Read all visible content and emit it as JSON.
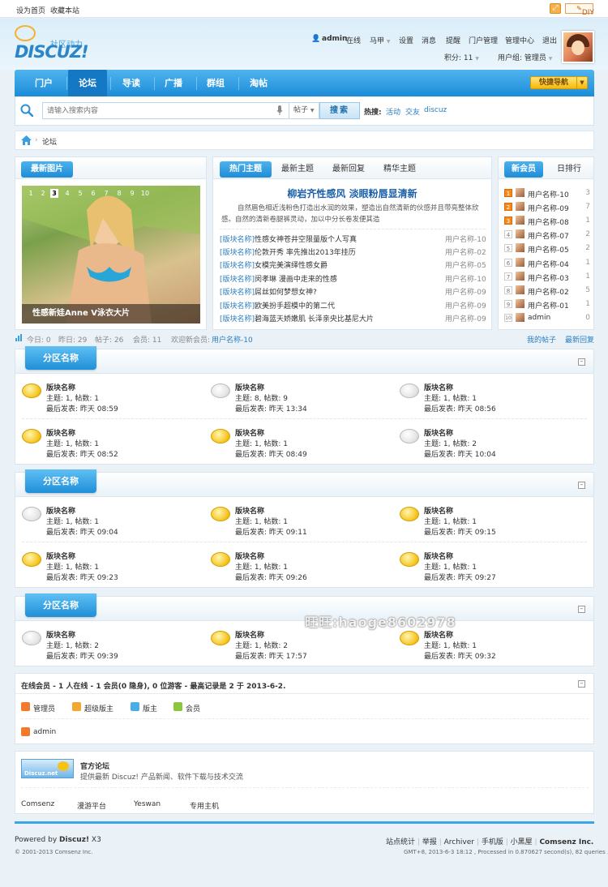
{
  "topbar": {
    "set_home": "设为首页",
    "bookmark": "收藏本站",
    "diy": "DIY"
  },
  "logo": {
    "main": "DISCUZ!",
    "sub": "社区动力"
  },
  "user": {
    "name": "admin",
    "status": "在线",
    "mount": "马甲",
    "settings": "设置",
    "messages": "消息",
    "remind": "提醒",
    "portal_manage": "门户管理",
    "admin_center": "管理中心",
    "logout": "退出",
    "points": "积分: 11",
    "group": "用户组: 管理员"
  },
  "nav": {
    "items": [
      "门户",
      "论坛",
      "导读",
      "广播",
      "群组",
      "淘帖"
    ],
    "active": 1,
    "quick_nav": "快捷导航"
  },
  "search": {
    "placeholder": "请输入搜索内容",
    "type": "帖子",
    "button": "搜索",
    "hot_label": "热搜:",
    "hot": [
      "活动",
      "交友",
      "discuz"
    ]
  },
  "breadcrumb": {
    "current": "论坛"
  },
  "photo_box": {
    "tab": "最新图片",
    "pages": [
      "1",
      "2",
      "3",
      "4",
      "5",
      "6",
      "7",
      "8",
      "9",
      "10"
    ],
    "current_page": 3,
    "caption": "性感新娃Anne V泳衣大片"
  },
  "threads_box": {
    "tabs": [
      "热门主题",
      "最新主题",
      "最新回复",
      "精华主题"
    ],
    "headline": "柳岩齐性感风 淡眼粉唇显清新",
    "summary": "自然眉色相近浅粉色打造出水润的效果，塑造出自然清新的伙感并且带亮整体欣感。自然的清新卷腿裤灵动，加以中分长卷发便其造",
    "items": [
      {
        "forum": "[版块名称]",
        "title": "性感女神苍井空限量版个人写真",
        "author": "用户名称-10"
      },
      {
        "forum": "[版块名称]",
        "title": "伦敦开秀 率先推出2013年挂历",
        "author": "用户名称-02"
      },
      {
        "forum": "[版块名称]",
        "title": "女模完美演绎性感女爵",
        "author": "用户名称-05"
      },
      {
        "forum": "[版块名称]",
        "title": "闵孝琳 漫画中走来的性感",
        "author": "用户名称-10"
      },
      {
        "forum": "[版块名称]",
        "title": "屌丝如何梦想女神?",
        "author": "用户名称-09"
      },
      {
        "forum": "[版块名称]",
        "title": "欧美扮手超模中的第二代",
        "author": "用户名称-09"
      },
      {
        "forum": "[版块名称]",
        "title": "碧海蓝天娇嫩肌 长泽亲央比基尼大片",
        "author": "用户名称-09"
      }
    ]
  },
  "members_box": {
    "tabs": [
      "新会员",
      "日排行"
    ],
    "items": [
      {
        "rank": "1",
        "name": "用户名称-10",
        "count": "3"
      },
      {
        "rank": "2",
        "name": "用户名称-09",
        "count": "7"
      },
      {
        "rank": "3",
        "name": "用户名称-08",
        "count": "1"
      },
      {
        "rank": "4",
        "name": "用户名称-07",
        "count": "2"
      },
      {
        "rank": "5",
        "name": "用户名称-05",
        "count": "2"
      },
      {
        "rank": "6",
        "name": "用户名称-04",
        "count": "1"
      },
      {
        "rank": "7",
        "name": "用户名称-03",
        "count": "1"
      },
      {
        "rank": "8",
        "name": "用户名称-02",
        "count": "5"
      },
      {
        "rank": "9",
        "name": "用户名称-01",
        "count": "1"
      },
      {
        "rank": "10",
        "name": "admin",
        "count": "0"
      }
    ]
  },
  "stats": {
    "today": "今日: 0",
    "yesterday": "昨日: 29",
    "posts": "帖子: 26",
    "members": "会员: 11",
    "welcome": "欢迎新会员:",
    "new_member": "用户名称-10",
    "my_posts": "我的帖子",
    "latest_replies": "最新回复"
  },
  "sections": [
    {
      "title": "分区名称",
      "forums": [
        {
          "name": "版块名称",
          "info": "主题: 1, 帖数: 1",
          "last": "最后发表: 昨天 08:59",
          "new": true
        },
        {
          "name": "版块名称",
          "info": "主题: 8, 帖数: 9",
          "last": "最后发表: 昨天 13:34",
          "new": false
        },
        {
          "name": "版块名称",
          "info": "主题: 1, 帖数: 1",
          "last": "最后发表: 昨天 08:56",
          "new": false
        },
        {
          "name": "版块名称",
          "info": "主题: 1, 帖数: 1",
          "last": "最后发表: 昨天 08:52",
          "new": true
        },
        {
          "name": "版块名称",
          "info": "主题: 1, 帖数: 1",
          "last": "最后发表: 昨天 08:49",
          "new": true
        },
        {
          "name": "版块名称",
          "info": "主题: 1, 帖数: 2",
          "last": "最后发表: 昨天 10:04",
          "new": false
        }
      ]
    },
    {
      "title": "分区名称",
      "forums": [
        {
          "name": "版块名称",
          "info": "主题: 1, 帖数: 1",
          "last": "最后发表: 昨天 09:04",
          "new": false
        },
        {
          "name": "版块名称",
          "info": "主题: 1, 帖数: 1",
          "last": "最后发表: 昨天 09:11",
          "new": true
        },
        {
          "name": "版块名称",
          "info": "主题: 1, 帖数: 1",
          "last": "最后发表: 昨天 09:15",
          "new": true
        },
        {
          "name": "版块名称",
          "info": "主题: 1, 帖数: 1",
          "last": "最后发表: 昨天 09:23",
          "new": true
        },
        {
          "name": "版块名称",
          "info": "主题: 1, 帖数: 1",
          "last": "最后发表: 昨天 09:26",
          "new": true
        },
        {
          "name": "版块名称",
          "info": "主题: 1, 帖数: 1",
          "last": "最后发表: 昨天 09:27",
          "new": true
        }
      ]
    },
    {
      "title": "分区名称",
      "forums": [
        {
          "name": "版块名称",
          "info": "主题: 1, 帖数: 2",
          "last": "最后发表: 昨天 09:39",
          "new": false
        },
        {
          "name": "版块名称",
          "info": "主题: 1, 帖数: 2",
          "last": "最后发表: 昨天 17:57",
          "new": true
        },
        {
          "name": "版块名称",
          "info": "主题: 1, 帖数: 1",
          "last": "最后发表: 昨天 09:32",
          "new": true
        }
      ]
    }
  ],
  "online": {
    "summary": "在线会员 - 1 人在线 - 1 会员(0 隐身), 0 位游客 - 最高记录是 2 于 2013-6-2.",
    "legend": [
      {
        "label": "管理员",
        "color": "#f27a2c"
      },
      {
        "label": "超级版主",
        "color": "#f0a830"
      },
      {
        "label": "版主",
        "color": "#49aee6"
      },
      {
        "label": "会员",
        "color": "#8cc63e"
      }
    ],
    "users": [
      "admin"
    ]
  },
  "links": {
    "official_title": "官方论坛",
    "official_desc": "提供最新 Discuz! 产品新闻、软件下载与技术交流",
    "logo_text": "Discuz.net",
    "items": [
      "Comsenz",
      "漫游平台",
      "Yeswan",
      "专用主机"
    ]
  },
  "watermark": "旺旺:haoge8602978",
  "footer": {
    "powered_prefix": "Powered by",
    "powered_brand": "Discuz!",
    "version": "X3",
    "copyright": "© 2001-2013 Comsenz Inc.",
    "links": [
      "站点统计",
      "举报",
      "Archiver",
      "手机版",
      "小黑屋"
    ],
    "company": "Comsenz Inc.",
    "gmt": "GMT+8, 2013-6-3 18:12 , Processed in 0.870627 second(s), 82 queries ."
  }
}
